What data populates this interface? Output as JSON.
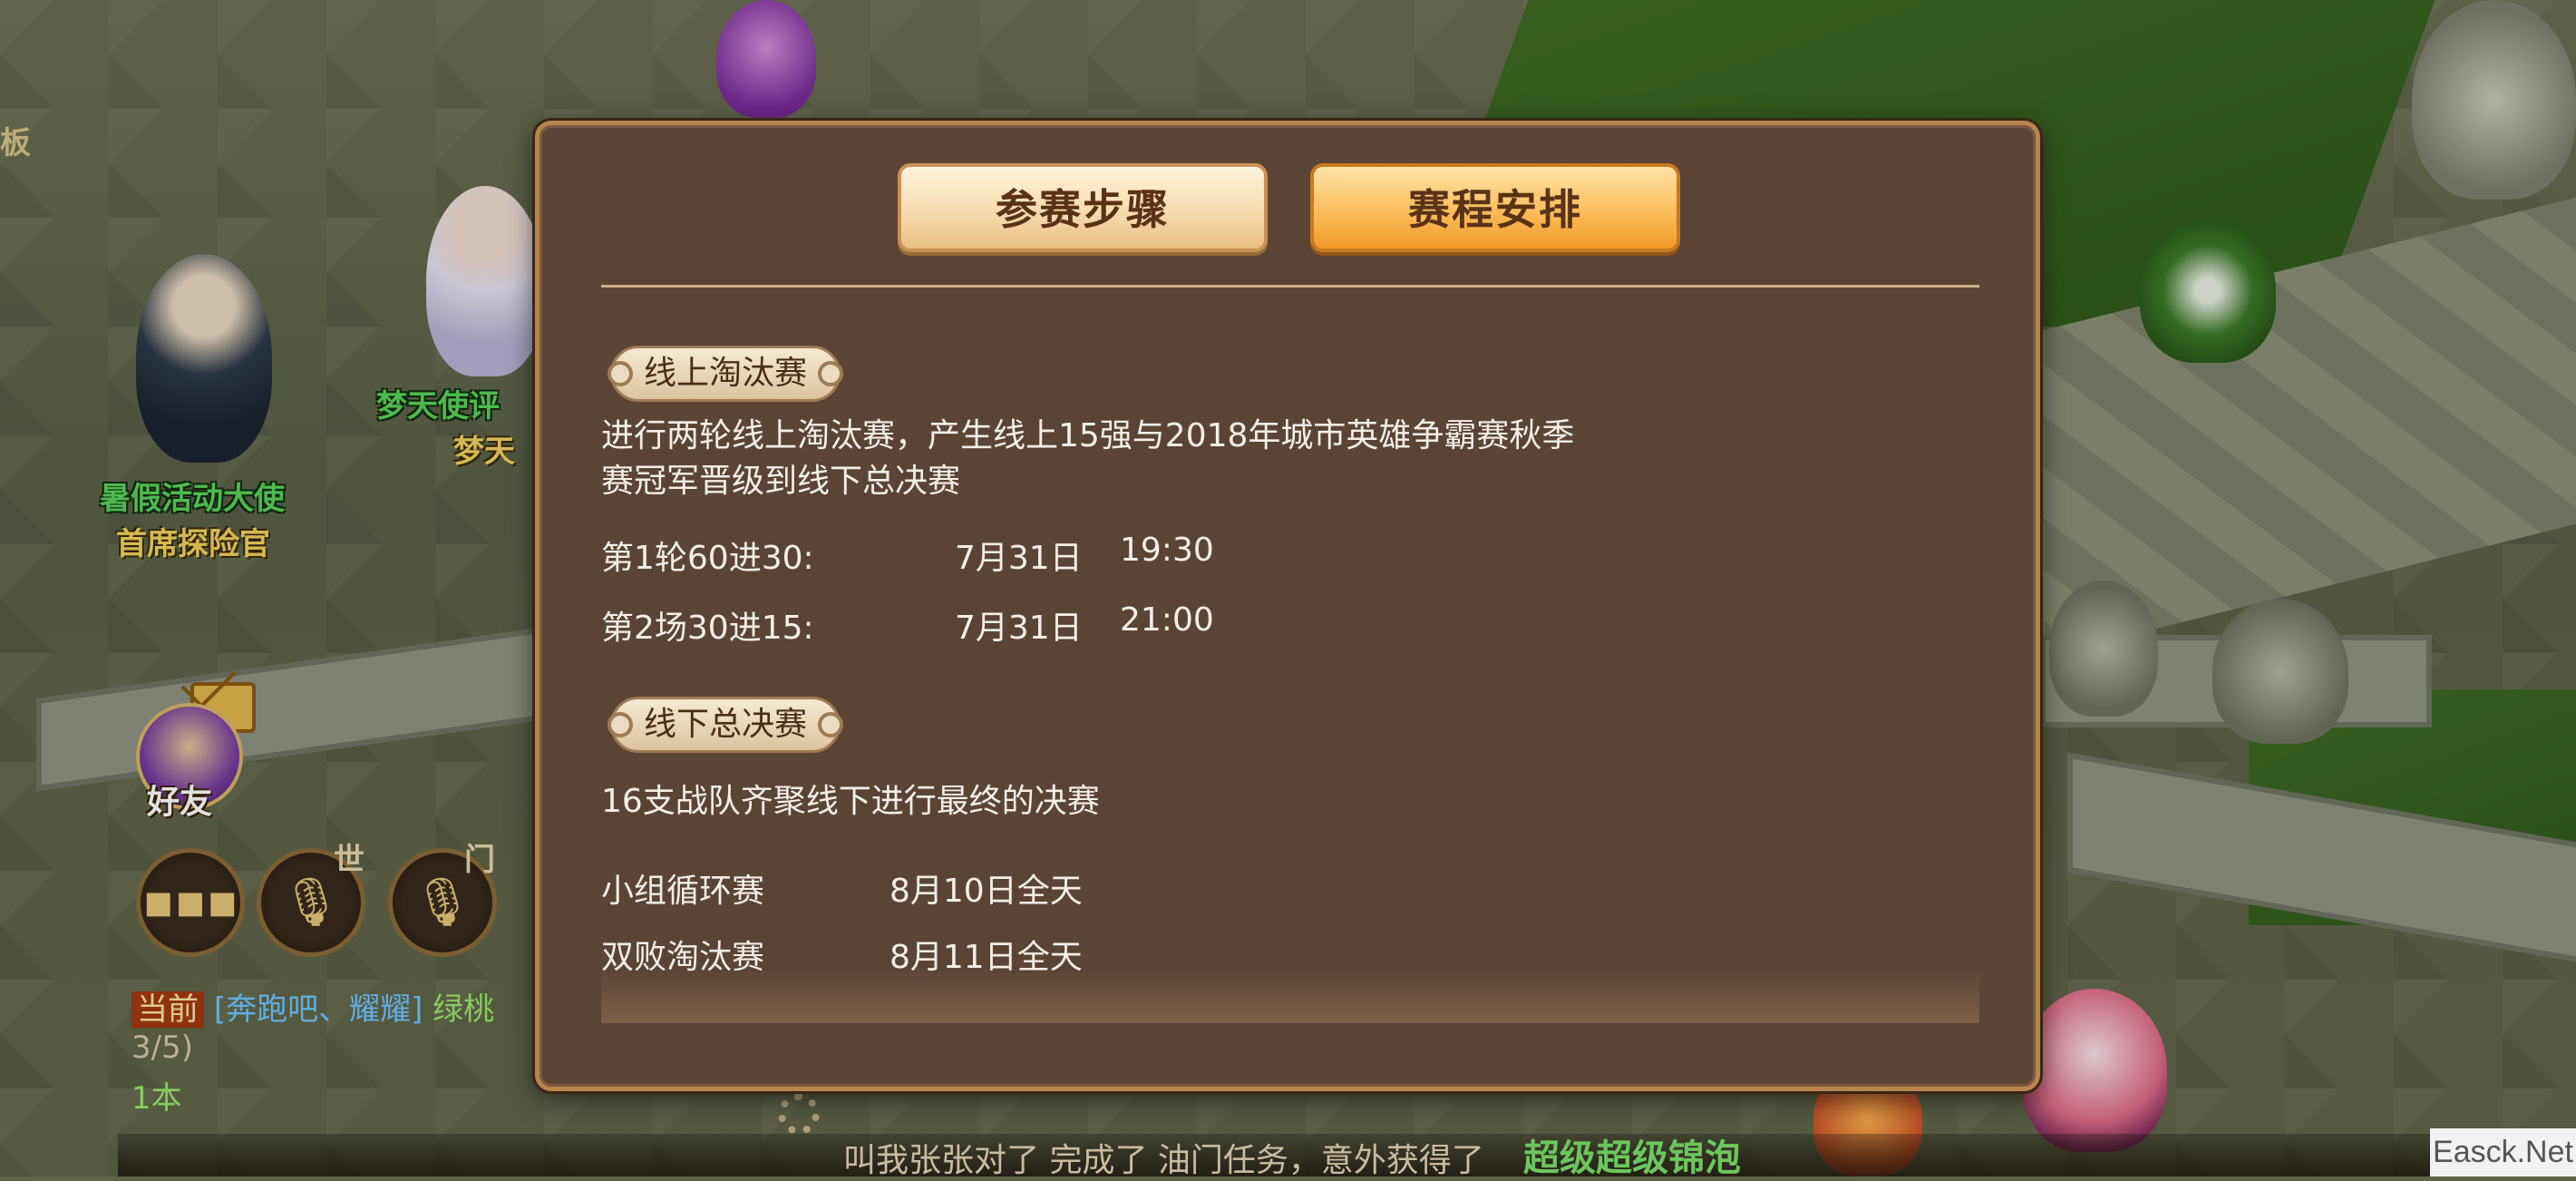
{
  "scene": {
    "npcs": [
      {
        "name": "暑假活动大使",
        "title": "首席探险官"
      },
      {
        "name": "梦天使评",
        "title": "梦天"
      }
    ],
    "edge_char": "板"
  },
  "hud": {
    "friend_label": "好友",
    "world_tag": "世",
    "team_tag": "门",
    "icons": [
      "mail-icon",
      "chat-icon",
      "mic-icon",
      "mic-icon",
      "gear-icon"
    ]
  },
  "chat": {
    "channel": "当前",
    "sender": "[奔跑吧、耀耀]",
    "message": "绿桃",
    "line2": "3/5)",
    "line3": "1本"
  },
  "ticker": {
    "text": "叫我张张对了 完成了 油门任务，意外获得了",
    "highlight": "超级超级锦泡"
  },
  "dialog": {
    "tabs": {
      "steps": "参赛步骤",
      "schedule": "赛程安排"
    },
    "online": {
      "tag": "线上淘汰赛",
      "desc_line1": "进行两轮线上淘汰赛，产生线上15强与2018年城市英雄争霸赛秋季",
      "desc_line2": "赛冠军晋级到线下总决赛",
      "rounds": [
        {
          "label": "第1轮60进30:",
          "date": "7月31日",
          "time": "19:30"
        },
        {
          "label": "第2场30进15:",
          "date": "7月31日",
          "time": "21:00"
        }
      ]
    },
    "offline": {
      "tag": "线下总决赛",
      "desc": "16支战队齐聚线下进行最终的决赛",
      "stages": [
        {
          "label": "小组循环赛",
          "date": "8月10日全天"
        },
        {
          "label": "双败淘汰赛",
          "date": "8月11日全天"
        }
      ]
    }
  },
  "watermark": "Easck.Net"
}
